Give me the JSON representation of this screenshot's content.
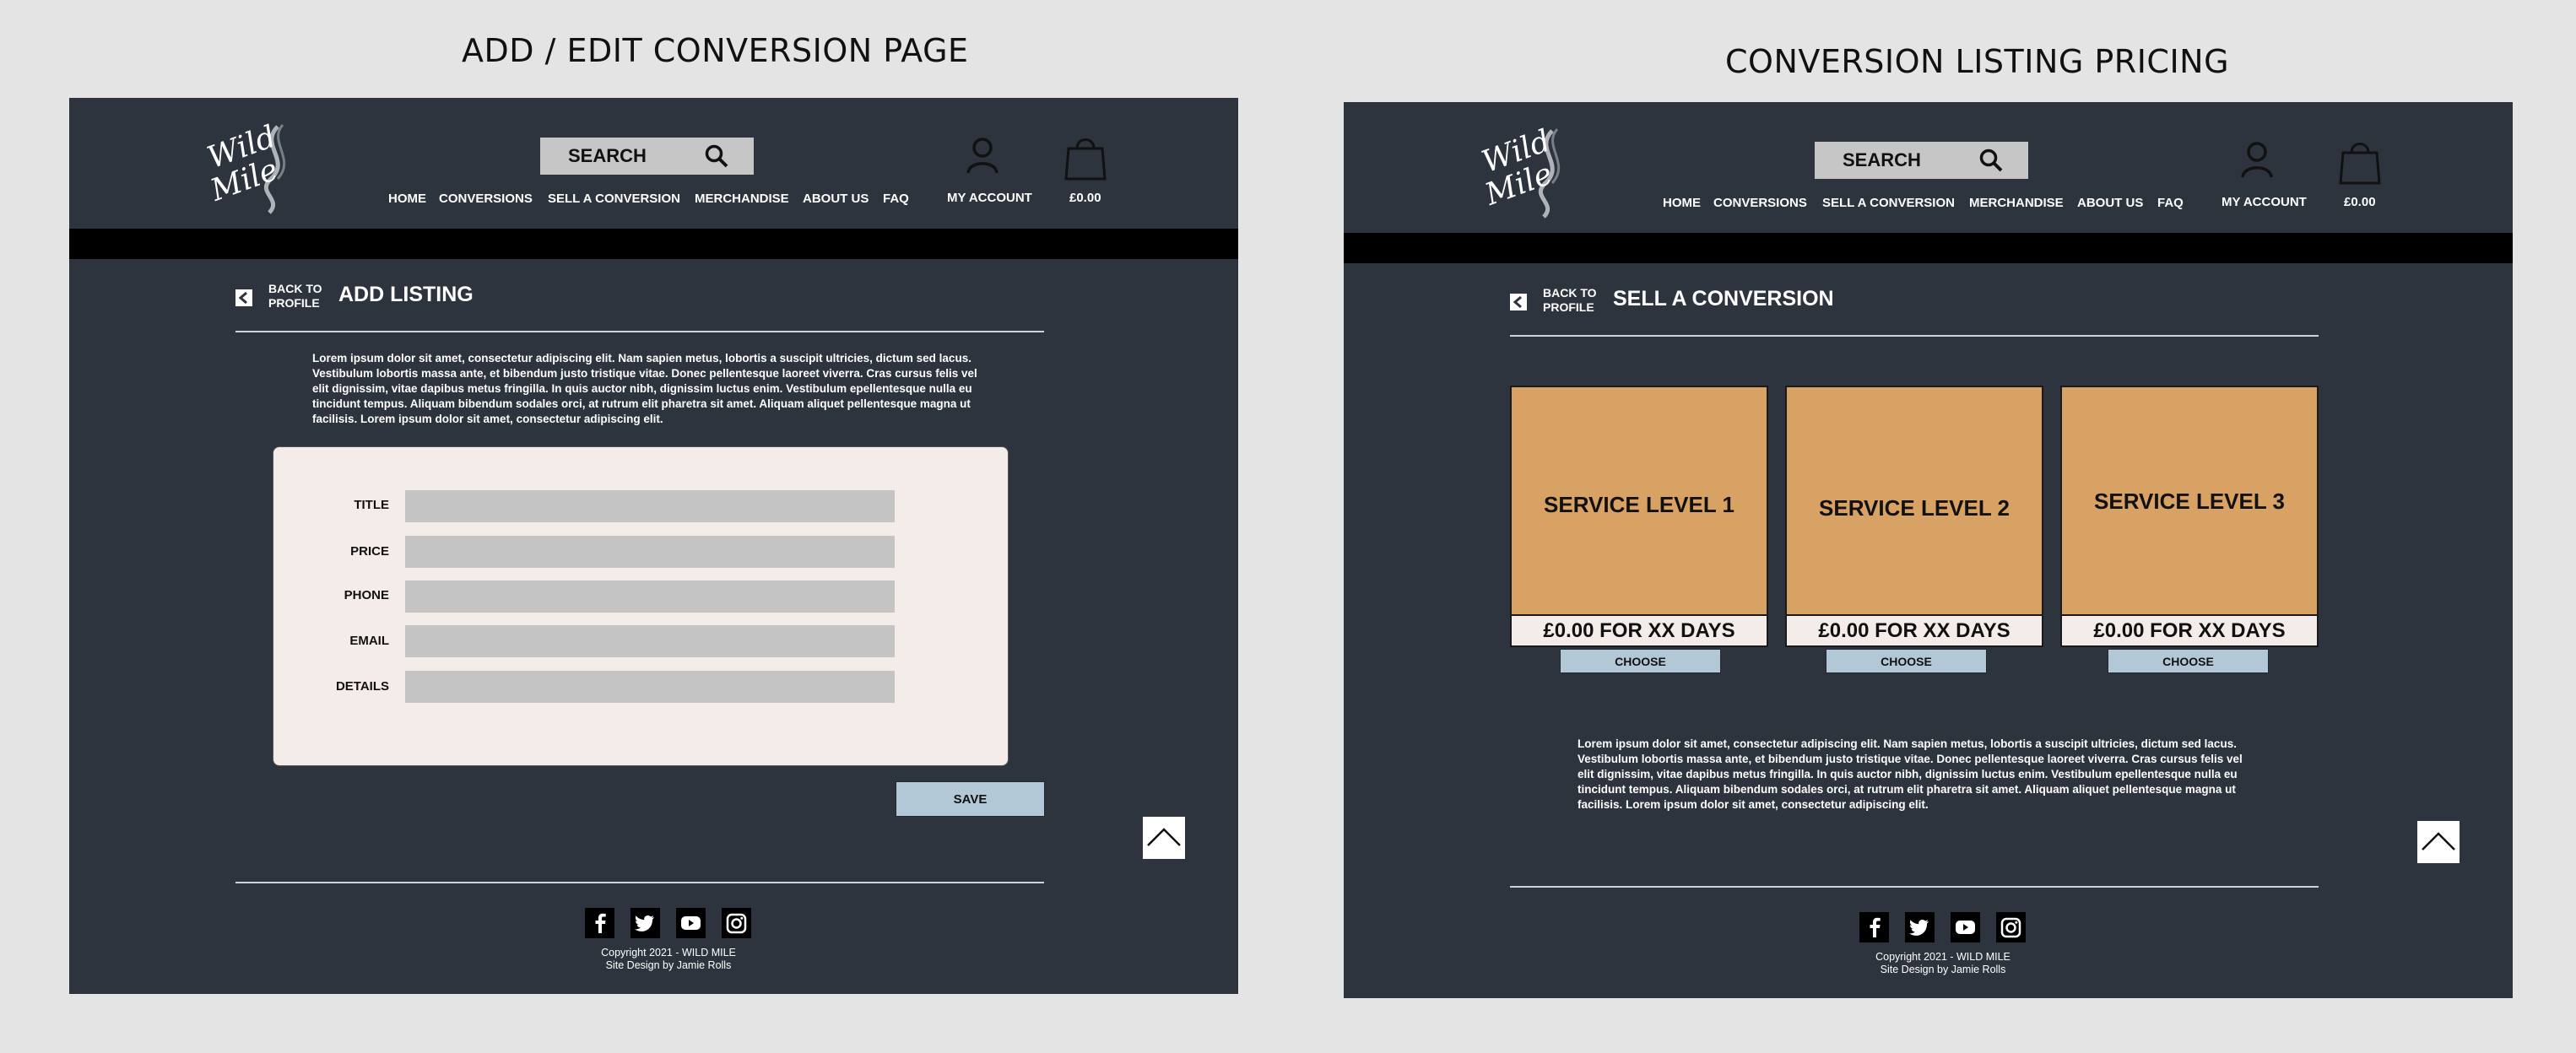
{
  "board": {
    "left_title": "ADD / EDIT CONVERSION PAGE",
    "right_title": "CONVERSION LISTING PRICING"
  },
  "header": {
    "logo_text_1": "Wild",
    "logo_text_2": "Mile",
    "search_label": "SEARCH",
    "nav": [
      "HOME",
      "CONVERSIONS",
      "SELL A CONVERSION",
      "MERCHANDISE",
      "ABOUT US",
      "FAQ"
    ],
    "account_label": "MY ACCOUNT",
    "cart_total": "£0.00"
  },
  "add_listing": {
    "back_line1": "BACK TO",
    "back_line2": "PROFILE",
    "title": "ADD LISTING",
    "intro": "Lorem ipsum dolor sit amet, consectetur adipiscing elit. Nam sapien metus, lobortis a suscipit ultricies, dictum sed lacus. Vestibulum lobortis massa ante, et bibendum justo tristique vitae. Donec pellentesque laoreet viverra. Cras cursus felis vel elit dignissim, vitae dapibus metus fringilla. In quis auctor nibh, dignissim luctus enim. Vestibulum epellentesque nulla eu tincidunt tempus. Aliquam bibendum sodales orci, at rutrum elit pharetra sit amet. Aliquam aliquet pellentesque magna ut facilisis. Lorem ipsum dolor sit amet, consectetur adipiscing elit.",
    "fields": [
      {
        "label": "TITLE",
        "value": ""
      },
      {
        "label": "PRICE",
        "value": ""
      },
      {
        "label": "PHONE",
        "value": ""
      },
      {
        "label": "EMAIL",
        "value": ""
      },
      {
        "label": "DETAILS",
        "value": ""
      }
    ],
    "save_label": "SAVE"
  },
  "sell_conversion": {
    "back_line1": "BACK TO",
    "back_line2": "PROFILE",
    "title": "SELL A CONVERSION",
    "levels": [
      {
        "name": "SERVICE LEVEL 1",
        "price": "£0.00 FOR XX DAYS",
        "choose": "CHOOSE"
      },
      {
        "name": "SERVICE LEVEL 2",
        "price": "£0.00 FOR XX DAYS",
        "choose": "CHOOSE"
      },
      {
        "name": "SERVICE LEVEL 3",
        "price": "£0.00 FOR XX DAYS",
        "choose": "CHOOSE"
      }
    ],
    "intro": "Lorem ipsum dolor sit amet, consectetur adipiscing elit. Nam sapien metus, lobortis a suscipit ultricies, dictum sed lacus. Vestibulum lobortis massa ante, et bibendum justo tristique vitae. Donec pellentesque laoreet viverra. Cras cursus felis vel elit dignissim, vitae dapibus metus fringilla. In quis auctor nibh, dignissim luctus enim. Vestibulum epellentesque nulla eu tincidunt tempus. Aliquam bibendum sodales orci, at rutrum elit pharetra sit amet. Aliquam aliquet pellentesque magna ut facilisis. Lorem ipsum dolor sit amet, consectetur adipiscing elit."
  },
  "footer": {
    "social_icons": [
      "facebook-icon",
      "twitter-icon",
      "youtube-icon",
      "instagram-icon"
    ],
    "copyright": "Copyright 2021 - WILD MILE",
    "credit": "Site Design by Jamie Rolls"
  },
  "colors": {
    "page_bg": "#2e343d",
    "accent_card": "#d9a265",
    "button": "#b3c8d7",
    "form_bg": "#f4ece8"
  }
}
